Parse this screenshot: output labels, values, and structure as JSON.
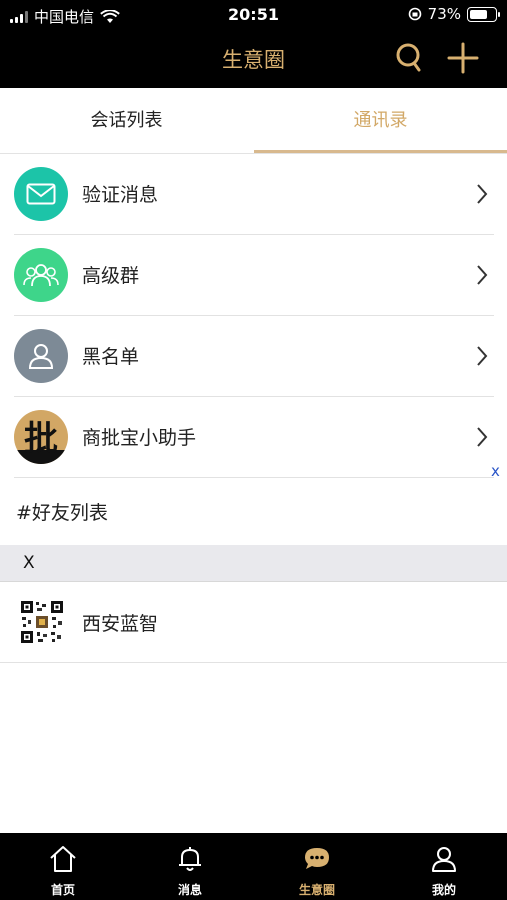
{
  "status_bar": {
    "carrier": "中国电信",
    "time": "20:51",
    "battery": "73%",
    "battery_level": 0.73
  },
  "nav": {
    "title": "生意圈",
    "search_icon": "search-icon",
    "add_icon": "plus-icon"
  },
  "tabs": [
    {
      "label": "会话列表"
    },
    {
      "label": "通讯录"
    }
  ],
  "menu": [
    {
      "label": "验证消息",
      "icon": "envelope-icon"
    },
    {
      "label": "高级群",
      "icon": "group-icon"
    },
    {
      "label": "黑名单",
      "icon": "person-icon"
    },
    {
      "label": "商批宝小助手",
      "icon": "pi-logo-icon",
      "logo_text": "批"
    }
  ],
  "close_label": "x",
  "section_title": "#好友列表",
  "index_letter": "X",
  "friends": [
    {
      "name": "西安蓝智"
    }
  ],
  "tabbar": [
    {
      "label": "首页",
      "icon": "home-icon"
    },
    {
      "label": "消息",
      "icon": "bell-icon"
    },
    {
      "label": "生意圈",
      "icon": "chat-bubble-icon"
    },
    {
      "label": "我的",
      "icon": "user-icon"
    }
  ],
  "colors": {
    "accent": "#d8b070",
    "teal": "#1cc4a8",
    "green": "#3ed58a",
    "gray": "#7d8a96"
  }
}
